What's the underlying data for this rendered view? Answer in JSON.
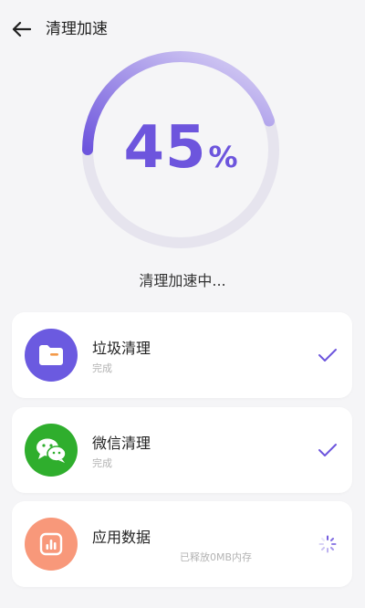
{
  "header": {
    "title": "清理加速",
    "back_icon": "arrow-left-icon"
  },
  "progress": {
    "value": 45,
    "number": "45",
    "unit": "%",
    "status": "清理加速中...",
    "accent": "#6d55dd",
    "track": "#e6e4ee"
  },
  "tasks": [
    {
      "name": "垃圾清理",
      "sub": "完成",
      "state": "done",
      "icon": "folder-icon",
      "icon_bg": "#6b5ae0"
    },
    {
      "name": "微信清理",
      "sub": "完成",
      "state": "done",
      "icon": "wechat-icon",
      "icon_bg": "#2fae2d"
    },
    {
      "name": "应用数据",
      "freed": "已释放0MB内存",
      "state": "loading",
      "icon": "bar-chart-icon",
      "icon_bg": "#f8987a"
    }
  ]
}
